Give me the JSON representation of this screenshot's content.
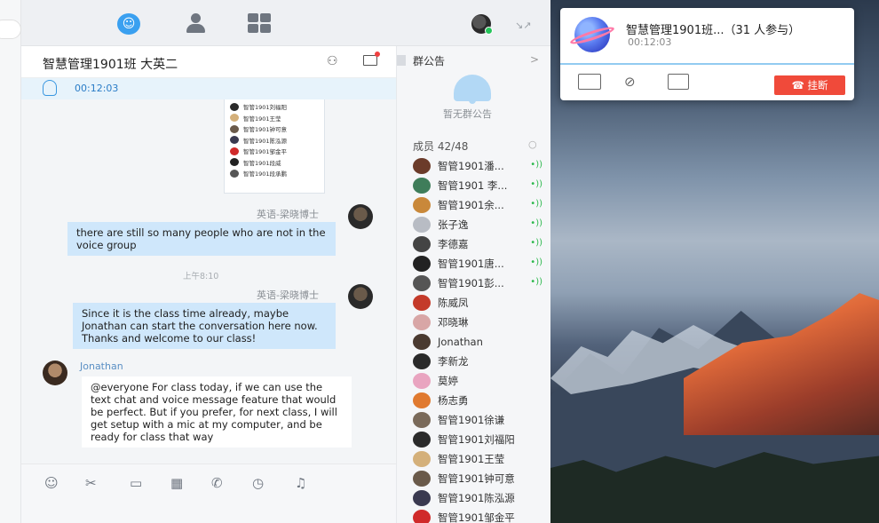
{
  "toolbar": {
    "chat_icon": "chat-bubble-icon",
    "contacts_icon": "person-icon",
    "apps_icon": "grid-icon",
    "shrink_icon": "shrink-icon"
  },
  "chat": {
    "title": "智慧管理1901班 大英二",
    "voice_time": "00:12:03",
    "member_image_rows": [
      "智管1901刘福阳",
      "智管1901王莹",
      "智管1901钟可意",
      "智管1901陈泓源",
      "智管1901邹金平",
      "智管1901段威",
      "智管1901段承鹏"
    ],
    "messages": [
      {
        "sender": "英语-梁晓博士",
        "text": "there are still so many people who are not in the voice group",
        "side": "right"
      },
      {
        "sender": "英语-梁晓博士",
        "text": "Since it is the class time already, maybe Jonathan can start the conversation here now. Thanks and welcome to our class!",
        "side": "right"
      },
      {
        "sender": "Jonathan",
        "text": "@everyone For class today, if we can use the text chat and voice message feature that would be perfect. But if you prefer, for next class, I will get setup with a mic at my computer, and be ready for class that way",
        "side": "left"
      }
    ],
    "time_separator": "上午8:10"
  },
  "side_panel": {
    "notice_title": "群公告",
    "notice_chevron": ">",
    "no_notice": "暂无群公告",
    "members_count": "成员 42/48",
    "members": [
      {
        "name": "智管1901潘...",
        "mic": true,
        "color": "#6b3b2a"
      },
      {
        "name": "智管1901 李...",
        "mic": true,
        "color": "#3f7d5a"
      },
      {
        "name": "智管1901余...",
        "mic": true,
        "color": "#c9883a"
      },
      {
        "name": "张子逸",
        "mic": true,
        "color": "#b8bcc4"
      },
      {
        "name": "李德嘉",
        "mic": true,
        "color": "#444"
      },
      {
        "name": "智管1901唐...",
        "mic": true,
        "color": "#222"
      },
      {
        "name": "智管1901彭...",
        "mic": true,
        "color": "#555"
      },
      {
        "name": "陈威凤",
        "mic": false,
        "color": "#c43a2a"
      },
      {
        "name": "邓晓琳",
        "mic": false,
        "color": "#d8a6a6"
      },
      {
        "name": "Jonathan",
        "mic": false,
        "color": "#4a3a30"
      },
      {
        "name": "李新龙",
        "mic": false,
        "color": "#2a2a2a"
      },
      {
        "name": "莫婷",
        "mic": false,
        "color": "#e9a4c0"
      },
      {
        "name": "杨志勇",
        "mic": false,
        "color": "#e07a30"
      },
      {
        "name": "智管1901徐谦",
        "mic": false,
        "color": "#7a6a5a"
      },
      {
        "name": "智管1901刘福阳",
        "mic": false,
        "color": "#2b2b2b"
      },
      {
        "name": "智管1901王莹",
        "mic": false,
        "color": "#d4b07a"
      },
      {
        "name": "智管1901钟可意",
        "mic": false,
        "color": "#6a5a4a"
      },
      {
        "name": "智管1901陈泓源",
        "mic": false,
        "color": "#3a3a50"
      },
      {
        "name": "智管1901邹金平",
        "mic": false,
        "color": "#d02a2a"
      }
    ]
  },
  "call": {
    "title": "智慧管理1901班...（31 人参与）",
    "time": "00:12:03",
    "hangup_label": "挂断"
  },
  "colors": {
    "accent": "#3aa0f0",
    "hangup": "#f04a3a",
    "mic_green": "#2db84d"
  }
}
